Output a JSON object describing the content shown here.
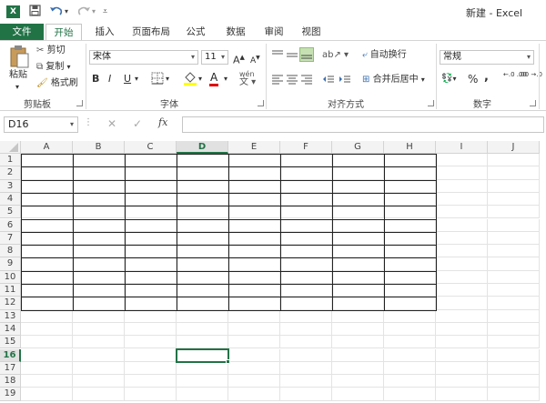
{
  "window": {
    "title": "新建 - Excel",
    "logo": "X",
    "accent": "#217346"
  },
  "quick_access": [
    "save-icon",
    "undo-icon",
    "redo-icon",
    "customize-icon"
  ],
  "tabs": [
    {
      "label": "文件"
    },
    {
      "label": "开始"
    },
    {
      "label": "插入"
    },
    {
      "label": "页面布局"
    },
    {
      "label": "公式"
    },
    {
      "label": "数据"
    },
    {
      "label": "审阅"
    },
    {
      "label": "视图"
    }
  ],
  "ribbon": {
    "clipboard": {
      "paste": "粘贴",
      "cut": "剪切",
      "copy": "复制",
      "format_painter": "格式刷",
      "label": "剪贴板"
    },
    "font": {
      "font_name": "宋体",
      "font_size": "11",
      "bold": "B",
      "italic": "I",
      "underline": "U",
      "grow": "A",
      "shrink": "A",
      "phonetic": "wén",
      "font_color": "A",
      "label": "字体"
    },
    "alignment": {
      "wrap_text": "自动换行",
      "merge_center": "合并后居中",
      "label": "对齐方式"
    },
    "number": {
      "format": "常规",
      "percent": "%",
      "comma": ",",
      "inc_decimal": "←.0 .00",
      "dec_decimal": ".00 →.0",
      "label": "数字"
    }
  },
  "formula_bar": {
    "name_box": "D16",
    "fx": "fx",
    "cancel": "✕",
    "confirm": "✓",
    "value": ""
  },
  "sheet": {
    "columns": [
      "A",
      "B",
      "C",
      "D",
      "E",
      "F",
      "G",
      "H",
      "I",
      "J"
    ],
    "rows": [
      "1",
      "2",
      "3",
      "4",
      "5",
      "6",
      "7",
      "8",
      "9",
      "10",
      "11",
      "12",
      "13",
      "14",
      "15",
      "16",
      "17",
      "18",
      "19"
    ],
    "active_cell": "D16"
  }
}
